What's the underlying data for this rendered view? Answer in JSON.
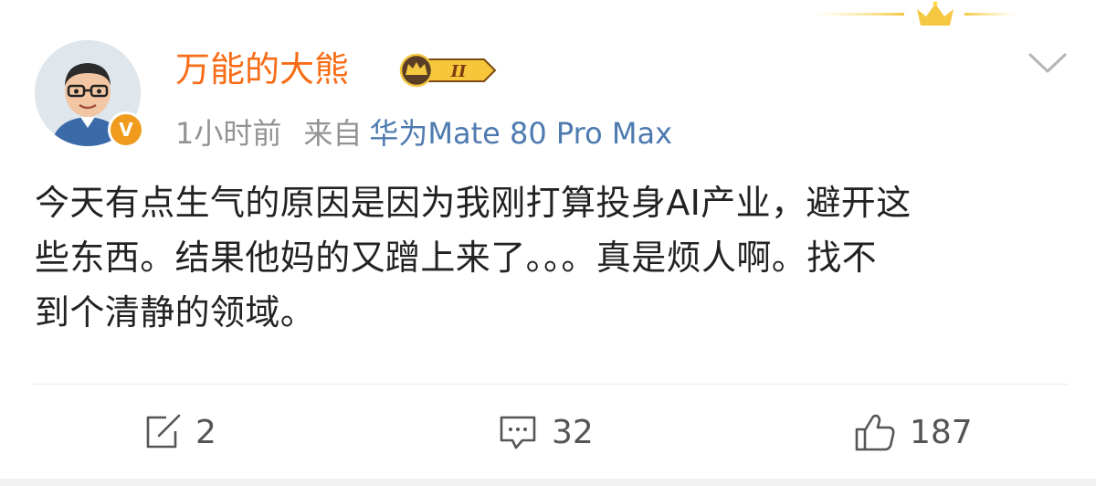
{
  "post": {
    "username": "万能的大熊",
    "member_level": "II",
    "verified_badge": "V",
    "time": "1小时前",
    "source_label": "来自",
    "source_device": "华为Mate 80 Pro Max",
    "content_lines": [
      "今天有点生气的原因是因为我刚打算投身AI产业，避开这",
      "些东西。结果他妈的又蹭上来了。。。真是烦人啊。找不",
      "到个清静的领域。"
    ]
  },
  "actions": {
    "repost_count": "2",
    "comment_count": "32",
    "like_count": "187"
  },
  "icons": {
    "repost": "edit-share-icon",
    "comment": "comment-bubble-icon",
    "like": "thumbs-up-icon",
    "more": "chevron-down-icon",
    "member": "crown-badge-icon"
  },
  "colors": {
    "username": "#f86c15",
    "link": "#4e7ab0",
    "meta": "#939393",
    "text": "#222222",
    "verified": "#f09b1d",
    "gold": "#f5c842"
  }
}
